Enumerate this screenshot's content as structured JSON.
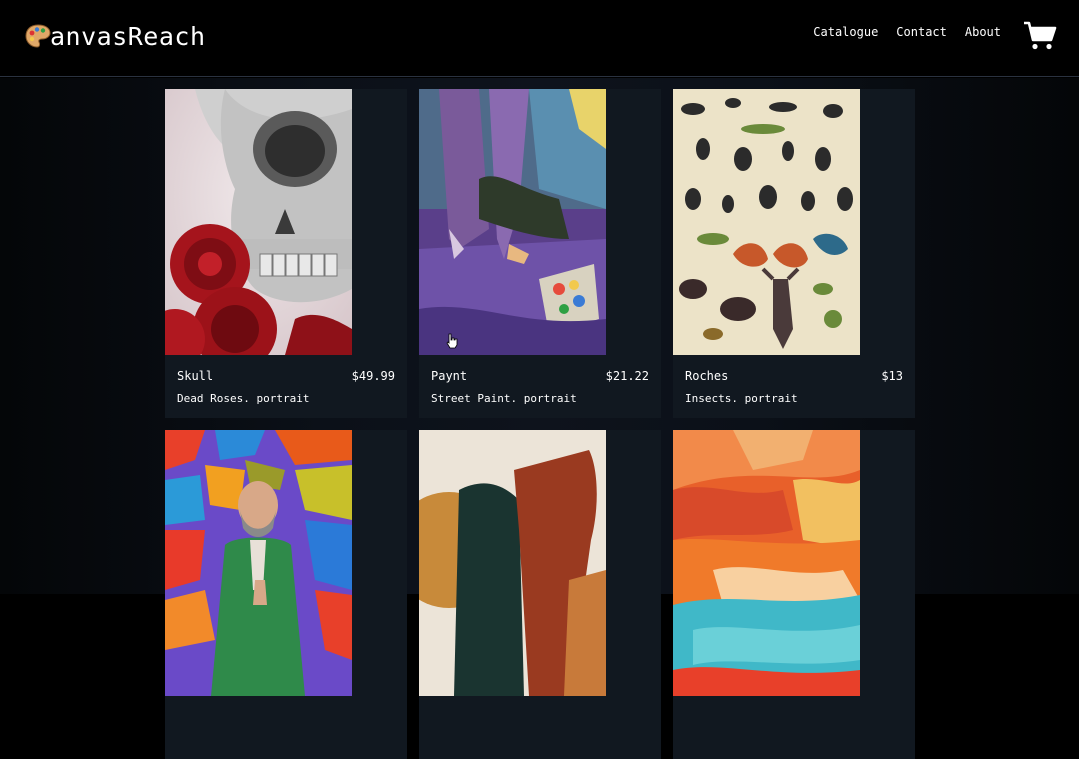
{
  "brand": {
    "logo_icon": "palette-icon",
    "name": "anvasReach"
  },
  "nav": {
    "items": [
      "Catalogue",
      "Contact",
      "About"
    ],
    "cart_icon": "shopping-cart-icon"
  },
  "products": [
    {
      "name": "Skull",
      "price": "$49.99",
      "description": "Dead Roses. portrait"
    },
    {
      "name": "Paynt",
      "price": "$21.22",
      "description": "Street Paint. portrait"
    },
    {
      "name": "Roches",
      "price": "$13",
      "description": "Insects. portrait"
    },
    {
      "name": "",
      "price": "",
      "description": ""
    },
    {
      "name": "",
      "price": "",
      "description": ""
    },
    {
      "name": "",
      "price": "",
      "description": ""
    }
  ],
  "colors": {
    "header_bg": "#000000",
    "card_bg": "#111820",
    "text": "#ffffff"
  }
}
